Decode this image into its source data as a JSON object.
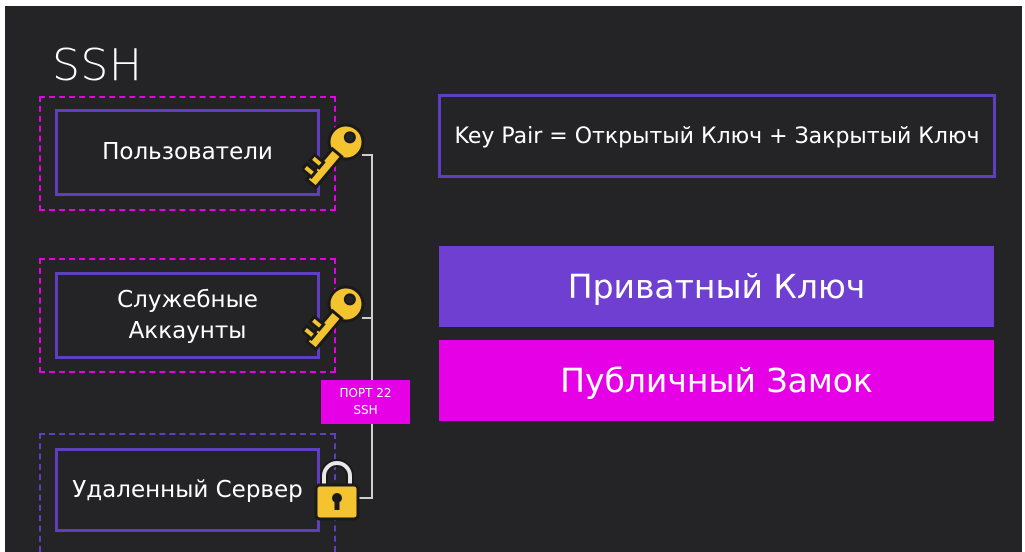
{
  "title": "SSH",
  "boxes": {
    "users": {
      "label": "Пользователи"
    },
    "service_accounts": {
      "line1": "Служебные",
      "line2": "Аккаунты"
    },
    "remote_server": {
      "label": "Удаленный Сервер"
    }
  },
  "port_badge": {
    "line1": "ПОРТ 22",
    "line2": "SSH"
  },
  "key_pair": "Key Pair = Открытый Ключ + Закрытый Ключ",
  "private_key": "Приватный Ключ",
  "public_lock": "Публичный Замок",
  "colors": {
    "background": "#242326",
    "purple": "#5e3fbf",
    "purple_fill": "#6e3fd1",
    "magenta": "#e600e6",
    "key_gold": "#f4c430"
  },
  "icons": [
    "key-icon",
    "key-icon",
    "padlock-icon"
  ]
}
